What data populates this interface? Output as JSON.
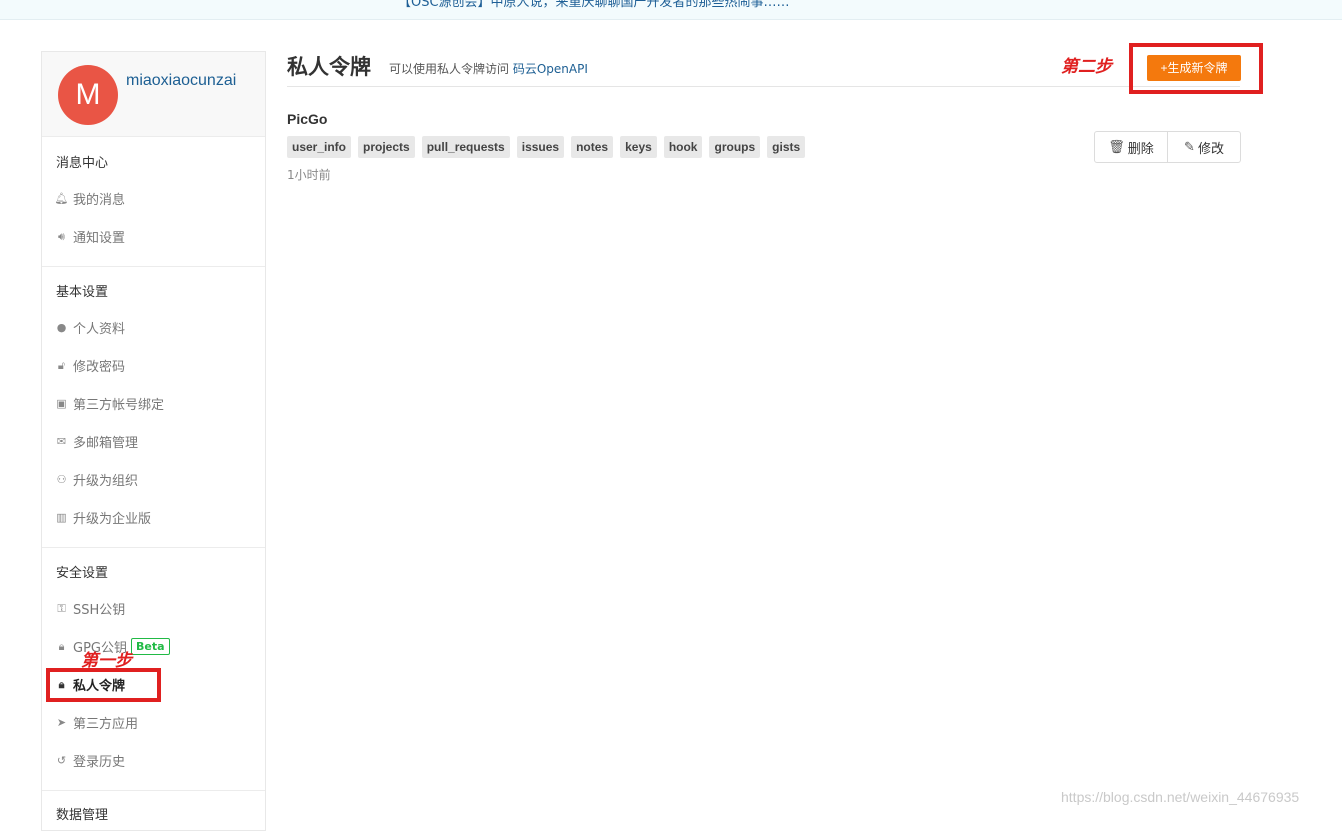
{
  "banner": {
    "text": "【OSC源创会】中原人说，来重庆聊聊国产开发者的那些热闹事……"
  },
  "user": {
    "avatar_letter": "M",
    "username": "miaoxiaocunzai",
    "avatar_color": "#e95545"
  },
  "sidebar": {
    "sections": [
      {
        "title": "消息中心",
        "items": [
          {
            "icon": "bell-icon",
            "label": "我的消息"
          },
          {
            "icon": "volume-icon",
            "label": "通知设置"
          }
        ]
      },
      {
        "title": "基本设置",
        "items": [
          {
            "icon": "user-icon",
            "label": "个人资料"
          },
          {
            "icon": "unlock-icon",
            "label": "修改密码"
          },
          {
            "icon": "id-card-icon",
            "label": "第三方帐号绑定"
          },
          {
            "icon": "mail-icon",
            "label": "多邮箱管理"
          },
          {
            "icon": "users-icon",
            "label": "升级为组织"
          },
          {
            "icon": "building-icon",
            "label": "升级为企业版"
          }
        ]
      },
      {
        "title": "安全设置",
        "items": [
          {
            "icon": "key-icon",
            "label": "SSH公钥"
          },
          {
            "icon": "lock-icon",
            "label": "GPG公钥",
            "badge": "Beta"
          },
          {
            "icon": "token-icon",
            "label": "私人令牌",
            "active": true
          },
          {
            "icon": "rocket-icon",
            "label": "第三方应用"
          },
          {
            "icon": "history-icon",
            "label": "登录历史"
          }
        ]
      },
      {
        "title": "数据管理",
        "items": []
      }
    ]
  },
  "page": {
    "title": "私人令牌",
    "subtitle_prefix": "可以使用私人令牌访问",
    "subtitle_link": "码云OpenAPI",
    "generate_button": "+生成新令牌",
    "accent_color": "#f4790d"
  },
  "token": {
    "name": "PicGo",
    "scopes": [
      "user_info",
      "projects",
      "pull_requests",
      "issues",
      "notes",
      "keys",
      "hook",
      "groups",
      "gists"
    ],
    "time": "1小时前",
    "delete_label": "删除",
    "edit_label": "修改"
  },
  "annotations": {
    "step1": "第一步",
    "step2": "第二步",
    "color": "#e02020"
  },
  "watermark": "https://blog.csdn.net/weixin_44676935"
}
